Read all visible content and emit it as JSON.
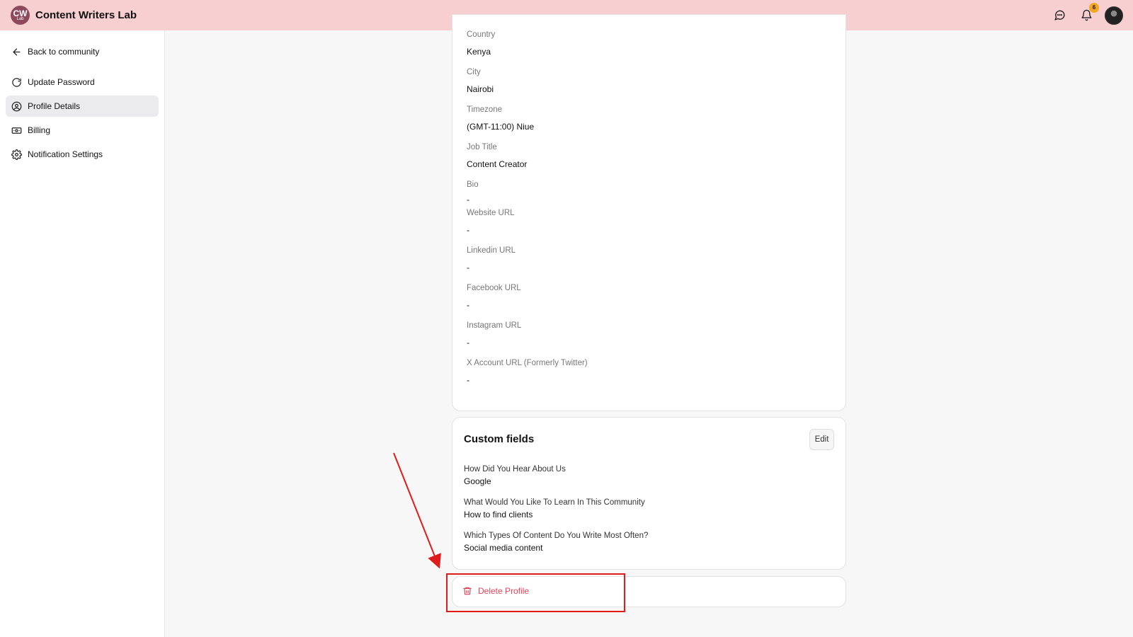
{
  "header": {
    "logo_text": "CW",
    "logo_sub": "Lab",
    "title": "Content Writers Lab",
    "notification_count": "6"
  },
  "sidebar": {
    "back": "Back to community",
    "items": [
      {
        "label": "Update Password",
        "icon": "refresh-icon"
      },
      {
        "label": "Profile Details",
        "icon": "user-circle-icon",
        "active": true
      },
      {
        "label": "Billing",
        "icon": "billing-icon"
      },
      {
        "label": "Notification Settings",
        "icon": "gear-icon"
      }
    ]
  },
  "profile": {
    "fields": [
      {
        "label": "Country",
        "value": "Kenya"
      },
      {
        "label": "City",
        "value": "Nairobi"
      },
      {
        "label": "Timezone",
        "value": "(GMT-11:00) Niue"
      },
      {
        "label": "Job Title",
        "value": "Content Creator"
      },
      {
        "label": "Bio",
        "value": "-"
      },
      {
        "label": "Website URL",
        "value": "-"
      },
      {
        "label": "Linkedin URL",
        "value": "-"
      },
      {
        "label": "Facebook URL",
        "value": "-"
      },
      {
        "label": "Instagram URL",
        "value": "-"
      },
      {
        "label": "X Account URL (Formerly Twitter)",
        "value": "-"
      }
    ]
  },
  "custom_fields": {
    "title": "Custom fields",
    "edit_label": "Edit",
    "items": [
      {
        "question": "How Did You Hear About Us",
        "answer": "Google"
      },
      {
        "question": "What Would You Like To Learn In This Community",
        "answer": "How to find clients"
      },
      {
        "question": "Which Types Of Content Do You Write Most Often?",
        "answer": "Social media content"
      }
    ]
  },
  "delete": {
    "label": "Delete Profile"
  },
  "colors": {
    "header_bg": "#f7cfd1",
    "danger": "#e0455a",
    "annotation": "#e01b1b"
  }
}
